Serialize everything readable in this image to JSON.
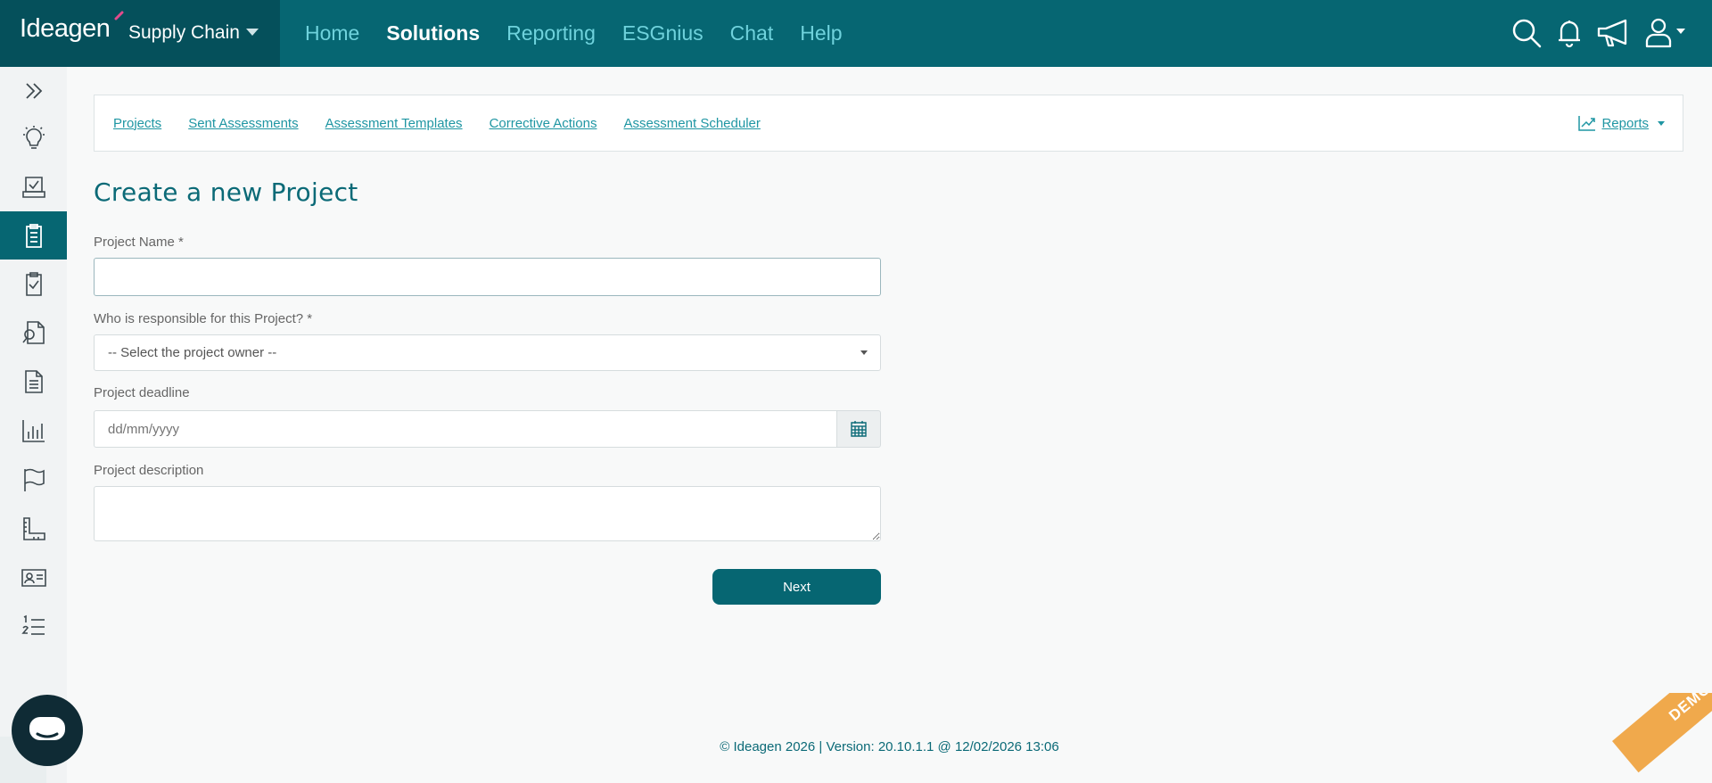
{
  "brand": {
    "logo_text": "Ideagen",
    "product": "Supply Chain"
  },
  "mainnav": {
    "items": [
      {
        "label": "Home",
        "active": false
      },
      {
        "label": "Solutions",
        "active": true
      },
      {
        "label": "Reporting",
        "active": false
      },
      {
        "label": "ESGnius",
        "active": false
      },
      {
        "label": "Chat",
        "active": false
      },
      {
        "label": "Help",
        "active": false
      }
    ]
  },
  "topbar_icons": [
    "search-icon",
    "bell-icon",
    "megaphone-icon",
    "user-icon"
  ],
  "sidebar": {
    "items": [
      {
        "icon": "expand-chevrons-icon",
        "active": false
      },
      {
        "icon": "lightbulb-icon",
        "active": false
      },
      {
        "icon": "inbox-check-icon",
        "active": false
      },
      {
        "icon": "clipboard-list-icon",
        "active": true
      },
      {
        "icon": "clipboard-check-icon",
        "active": false
      },
      {
        "icon": "document-search-icon",
        "active": false
      },
      {
        "icon": "document-text-icon",
        "active": false
      },
      {
        "icon": "bar-chart-icon",
        "active": false
      },
      {
        "icon": "flag-icon",
        "active": false
      },
      {
        "icon": "ruler-icon",
        "active": false
      },
      {
        "icon": "id-card-icon",
        "active": false
      },
      {
        "icon": "numbered-list-icon",
        "active": false
      }
    ]
  },
  "subnav": {
    "links": [
      "Projects",
      "Sent Assessments",
      "Assessment Templates",
      "Corrective Actions",
      "Assessment Scheduler"
    ],
    "reports_label": "Reports"
  },
  "form": {
    "title": "Create a new Project",
    "project_name_label": "Project Name *",
    "project_name_value": "",
    "owner_label": "Who is responsible for this Project? *",
    "owner_selected": "-- Select the project owner --",
    "deadline_label": "Project deadline",
    "deadline_placeholder": "dd/mm/yyyy",
    "description_label": "Project description",
    "description_value": "",
    "next_label": "Next"
  },
  "footer": {
    "text": "© Ideagen 2026 | Version: 20.10.1.1 @ 12/02/2026 13:06"
  },
  "demo_label": "DEMO",
  "colors": {
    "topbar": "#066672",
    "brand_block": "#05505b",
    "nav_link": "#6fd2dc",
    "accent": "#1f96a3",
    "title": "#0b6a77",
    "demo_ribbon": "#f0a94c"
  }
}
